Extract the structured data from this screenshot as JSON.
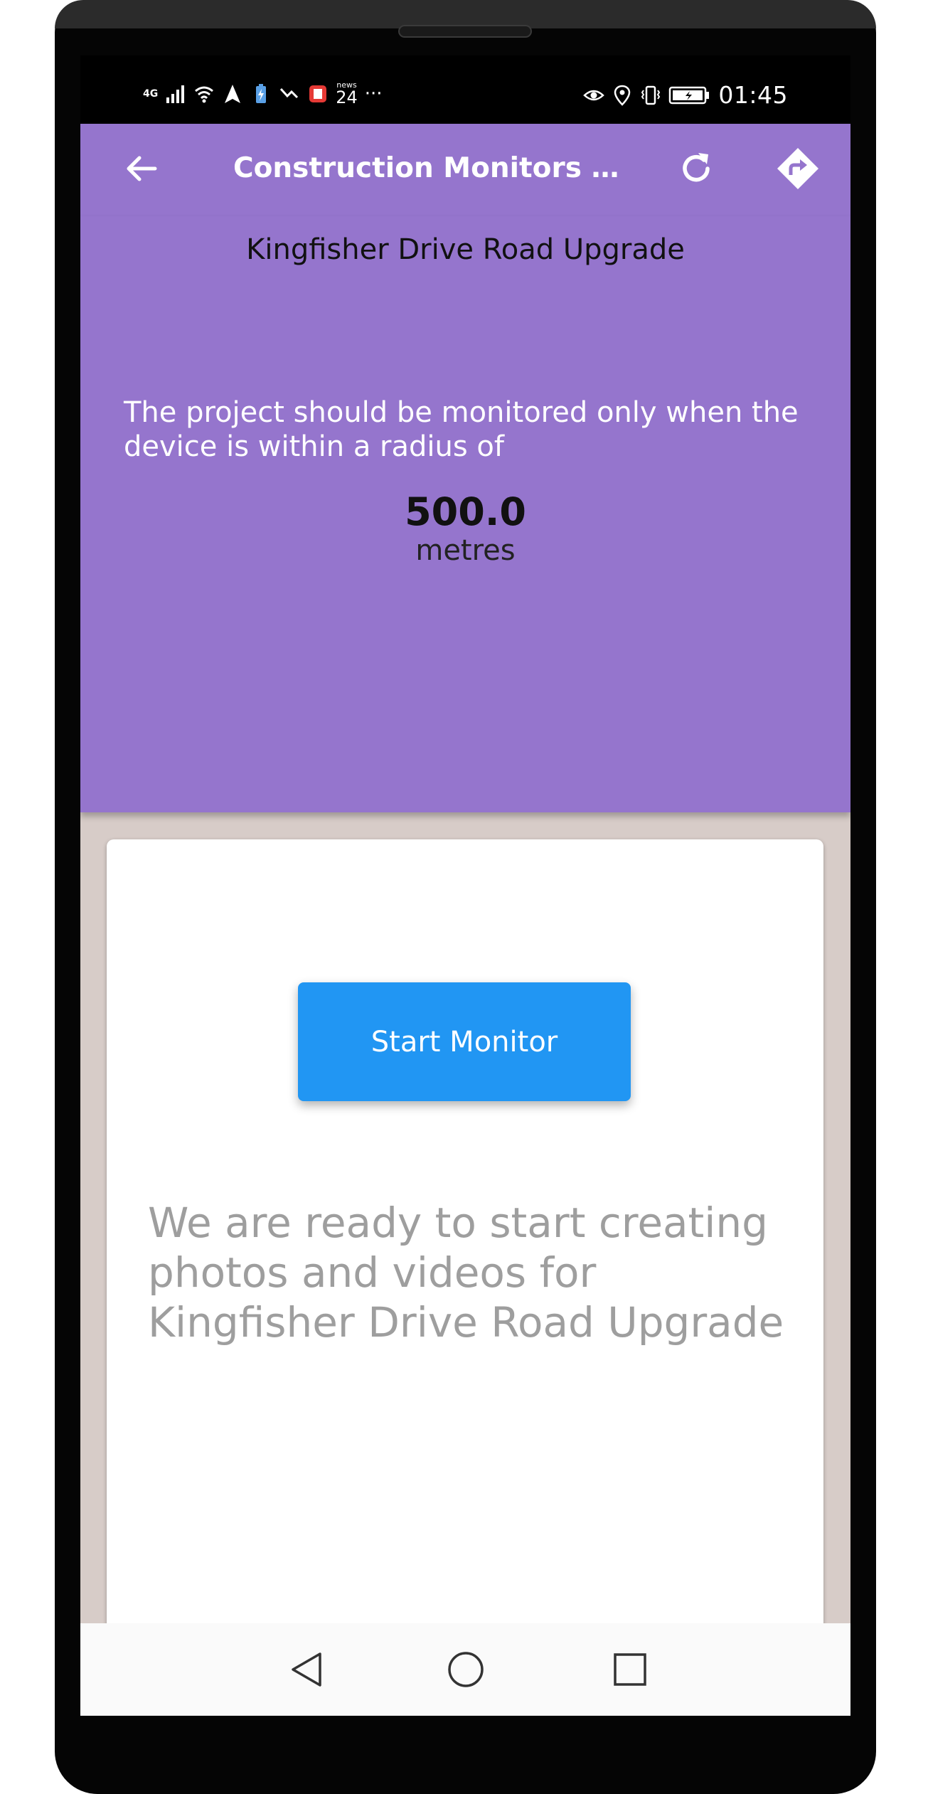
{
  "status_bar": {
    "network_label": "4G",
    "news_top": "news",
    "news_bottom": "24",
    "more": "···",
    "time": "01:45"
  },
  "app_bar": {
    "title": "Construction Monitors Pty...",
    "back_icon": "arrow-back-icon",
    "refresh_icon": "refresh-icon",
    "directions_icon": "directions-icon"
  },
  "header": {
    "project_name": "Kingfisher Drive Road Upgrade",
    "radius_description": "The project should be monitored only when the device is within a radius of",
    "radius_value": "500.0",
    "radius_unit": "metres"
  },
  "card": {
    "start_button_label": "Start Monitor",
    "ready_message": "We are ready to start creating photos and videos for Kingfisher Drive Road Upgrade"
  },
  "colors": {
    "app_bar": "#9575cd",
    "button": "#2196f3",
    "content_bg": "#d7ccc8",
    "ready_text": "#9e9e9e"
  }
}
